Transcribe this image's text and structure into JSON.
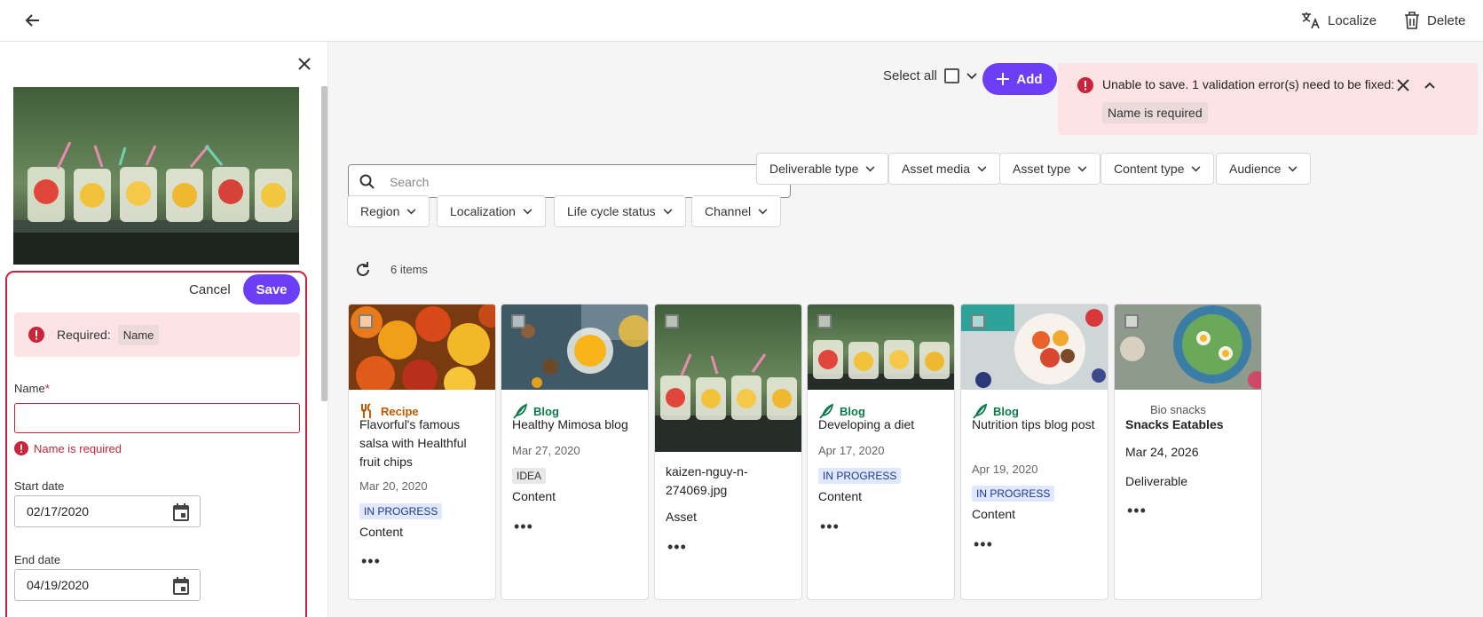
{
  "topbar": {
    "localize_label": "Localize",
    "delete_label": "Delete"
  },
  "form": {
    "cancel_label": "Cancel",
    "save_label": "Save",
    "required_label": "Required:",
    "required_field": "Name",
    "name_label": "Name",
    "required_mark": "*",
    "name_value": "",
    "name_error": "Name is required",
    "start_label": "Start date",
    "start_value": "02/17/2020",
    "end_label": "End date",
    "end_value": "04/19/2020"
  },
  "toolbar": {
    "select_all_label": "Select all",
    "add_label": "Add"
  },
  "toast": {
    "message": "Unable to save. 1 validation error(s) need to be fixed:",
    "error_chip": "Name is required"
  },
  "search": {
    "placeholder": "Search"
  },
  "filters": [
    "Deliverable type",
    "Asset media",
    "Asset type",
    "Content type",
    "Audience",
    "Region",
    "Localization",
    "Life cycle status",
    "Channel"
  ],
  "items_count": "6 items",
  "cards": [
    {
      "tag": "Recipe",
      "tag_color": "#c05a00",
      "title": "Flavorful's famous salsa with Healthful fruit chips",
      "date": "Mar 20, 2020",
      "badge": "IN PROGRESS",
      "kind": "Content"
    },
    {
      "tag": "Blog",
      "tag_color": "#0b7a4b",
      "title": "Healthy Mimosa blog",
      "date": "Mar 27, 2020",
      "badge": "IDEA",
      "kind": "Content"
    },
    {
      "tag": "",
      "title": "kaizen-nguy-n-274069.jpg",
      "kind": "Asset"
    },
    {
      "tag": "Blog",
      "tag_color": "#0b7a4b",
      "title": "Developing a diet",
      "date": "Apr 17, 2020",
      "badge": "IN PROGRESS",
      "kind": "Content"
    },
    {
      "tag": "Blog",
      "tag_color": "#0b7a4b",
      "title": "Nutrition tips blog post",
      "date": "Apr 19, 2020",
      "badge": "IN PROGRESS",
      "kind": "Content"
    },
    {
      "tag": "Bio snacks",
      "title": "Snacks Eatables",
      "date": "Mar 24, 2026",
      "kind": "Deliverable"
    }
  ],
  "more_label": "•••",
  "colors": {
    "accent": "#6c3ef5",
    "error": "#c9243a",
    "error_bg": "#fde3e3",
    "badge_progress_bg": "#dfe8ff",
    "badge_idea_bg": "#e8e8e8"
  }
}
